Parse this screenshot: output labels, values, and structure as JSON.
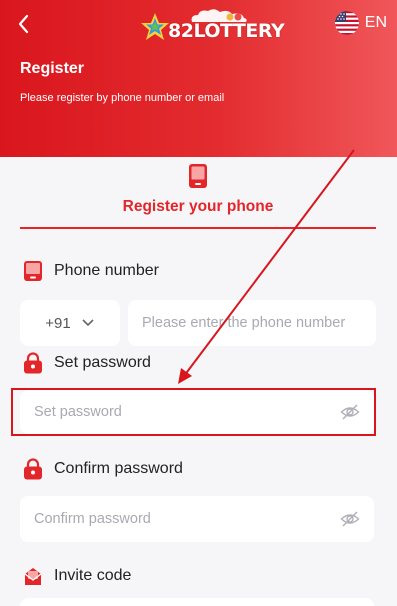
{
  "header": {
    "logo_text": "82LOTTERY",
    "lang": "EN",
    "title": "Register",
    "subtitle": "Please register by phone number or email"
  },
  "tab": {
    "label": "Register your phone"
  },
  "phone": {
    "label": "Phone number",
    "country_code": "+91",
    "placeholder": "Please enter the phone number"
  },
  "password": {
    "label": "Set password",
    "placeholder": "Set password"
  },
  "confirm": {
    "label": "Confirm password",
    "placeholder": "Confirm password"
  },
  "invite": {
    "label": "Invite code"
  },
  "colors": {
    "accent": "#e2262a",
    "header_start": "#d9161d",
    "header_end": "#f0575a"
  },
  "icons": [
    "back-arrow-icon",
    "us-flag-icon",
    "phone-icon",
    "lock-icon",
    "eye-off-icon",
    "invite-icon",
    "chevron-down-icon"
  ]
}
